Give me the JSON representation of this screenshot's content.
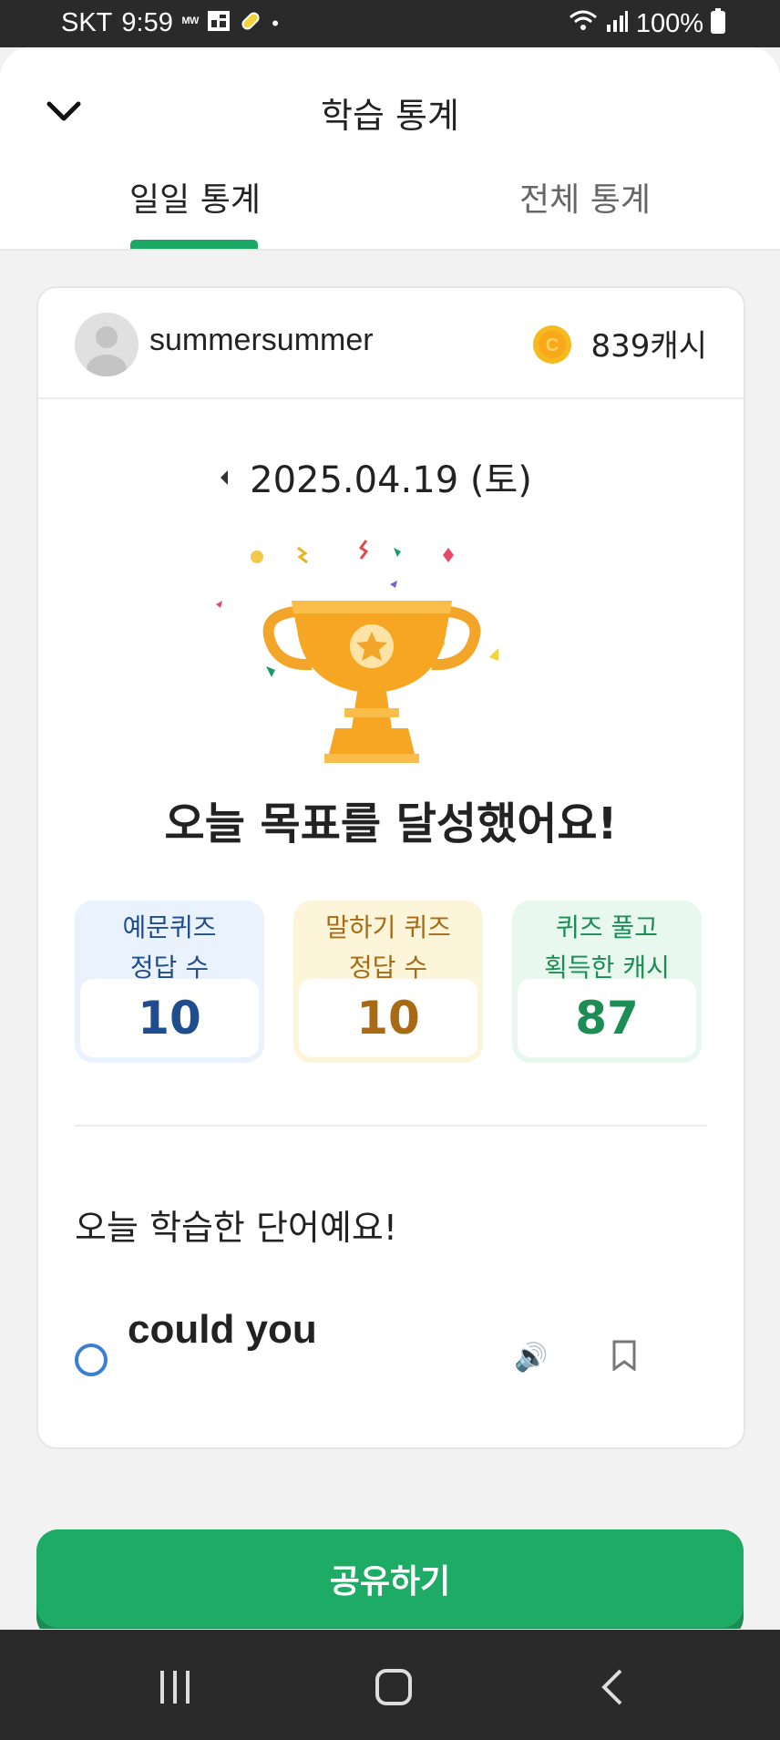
{
  "status_bar": {
    "carrier": "SKT",
    "time": "9:59",
    "battery": "100%",
    "icons": [
      "mw-icon",
      "grid-app-icon",
      "pill-icon",
      "dot-icon",
      "wifi-icon",
      "signal-icon",
      "battery-icon"
    ]
  },
  "header": {
    "title": "학습 통계",
    "back_icon": "chevron-down-icon",
    "tabs": [
      {
        "label": "일일 통계",
        "active": true
      },
      {
        "label": "전체 통계",
        "active": false
      }
    ],
    "accent_color": "#1ea866"
  },
  "card": {
    "username": "summersummer",
    "cash": "839캐시",
    "date": "2025.04.19 (토)",
    "goal_message": "오늘 목표를 달성했어요!",
    "stats": [
      {
        "label_line1": "예문퀴즈",
        "label_line2": "정답 수",
        "value": "10",
        "color": "#1f4d8f"
      },
      {
        "label_line1": "말하기 퀴즈",
        "label_line2": "정답 수",
        "value": "10",
        "color": "#a86b14"
      },
      {
        "label_line1": "퀴즈 풀고",
        "label_line2": "획득한 캐시",
        "value": "87",
        "color": "#1b8d55"
      }
    ],
    "section_title": "오늘 학습한 단어예요!",
    "words": [
      {
        "text": "could you"
      }
    ]
  },
  "share_button": {
    "label": "공유하기",
    "color": "#1eab66"
  },
  "nav_bar": {
    "icons": [
      "recent-apps-icon",
      "home-icon",
      "back-icon"
    ]
  }
}
